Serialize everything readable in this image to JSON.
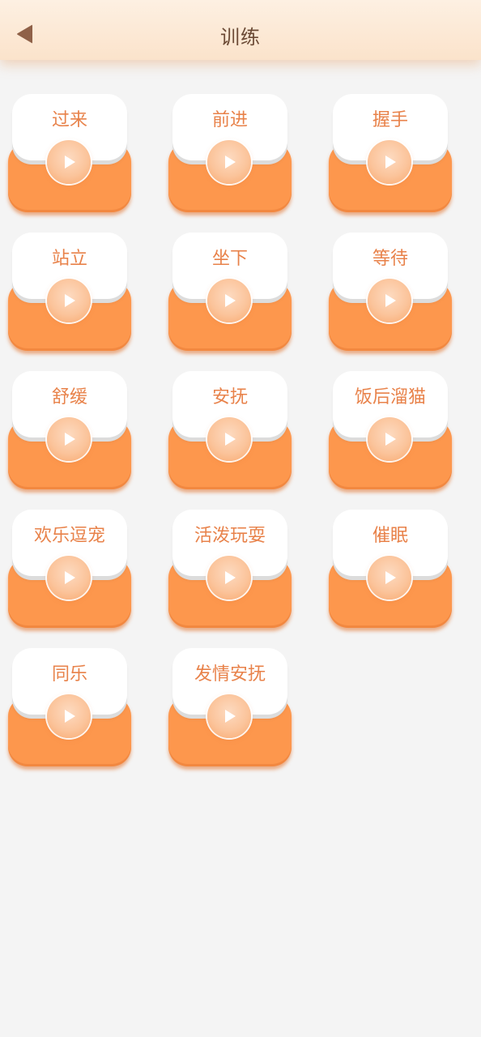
{
  "header": {
    "title": "训练",
    "back_icon": "back-arrow-icon"
  },
  "colors": {
    "header_bg": "#fbe6d0",
    "card_orange": "#fd974d",
    "label": "#e8824a",
    "title": "#6b4a35"
  },
  "commands": [
    {
      "label": "过来",
      "icon": "play-icon"
    },
    {
      "label": "前进",
      "icon": "play-icon"
    },
    {
      "label": "握手",
      "icon": "play-icon"
    },
    {
      "label": "站立",
      "icon": "play-icon"
    },
    {
      "label": "坐下",
      "icon": "play-icon"
    },
    {
      "label": "等待",
      "icon": "play-icon"
    },
    {
      "label": "舒缓",
      "icon": "play-icon"
    },
    {
      "label": "安抚",
      "icon": "play-icon"
    },
    {
      "label": "饭后溜猫",
      "icon": "play-icon"
    },
    {
      "label": "欢乐逗宠",
      "icon": "play-icon"
    },
    {
      "label": "活泼玩耍",
      "icon": "play-icon"
    },
    {
      "label": "催眠",
      "icon": "play-icon"
    },
    {
      "label": "同乐",
      "icon": "play-icon"
    },
    {
      "label": "发情安抚",
      "icon": "play-icon"
    }
  ]
}
